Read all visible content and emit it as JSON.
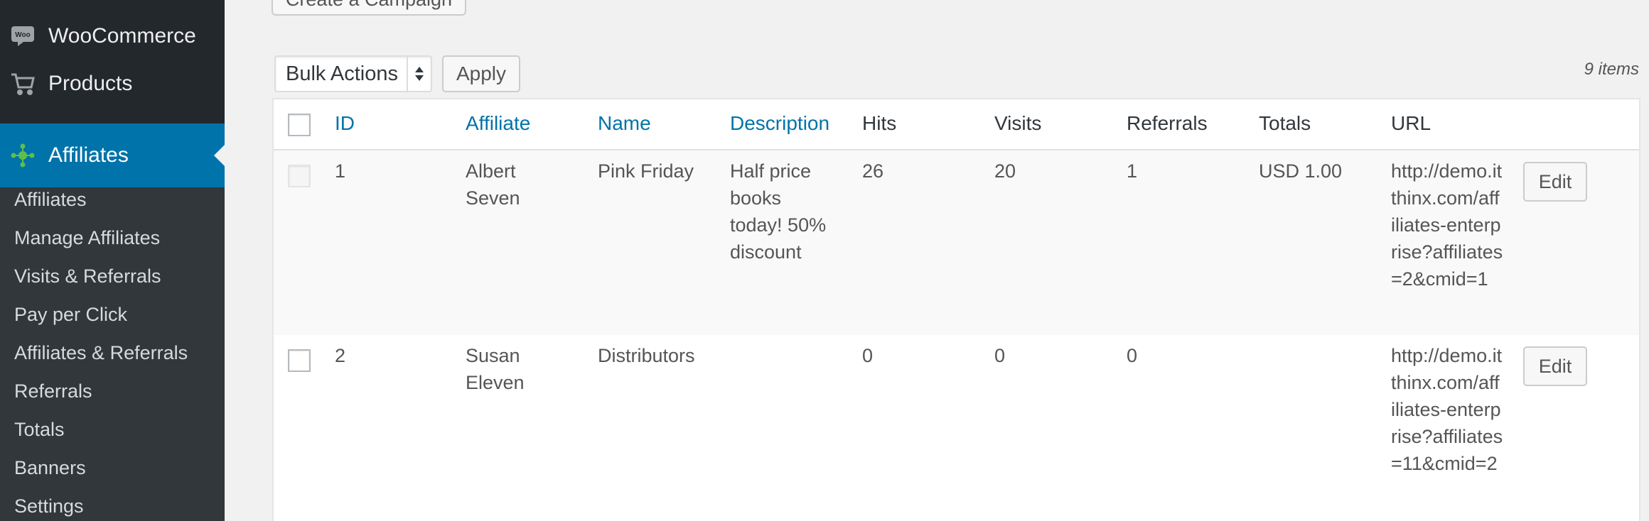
{
  "sidebar": {
    "woocommerce_label": "WooCommerce",
    "woocommerce_icon_text": "Woo",
    "products_label": "Products",
    "affiliates_label": "Affiliates",
    "submenu": [
      "Affiliates",
      "Manage Affiliates",
      "Visits & Referrals",
      "Pay per Click",
      "Affiliates & Referrals",
      "Referrals",
      "Totals",
      "Banners",
      "Settings"
    ]
  },
  "toolbar": {
    "create_campaign_label": "Create a Campaign",
    "bulk_actions_label": "Bulk Actions",
    "apply_label": "Apply",
    "items_count": "9 items"
  },
  "table": {
    "columns": {
      "id": "ID",
      "affiliate": "Affiliate",
      "name": "Name",
      "description": "Description",
      "hits": "Hits",
      "visits": "Visits",
      "referrals": "Referrals",
      "totals": "Totals",
      "url": "URL"
    },
    "edit_label": "Edit",
    "rows": [
      {
        "id": "1",
        "affiliate": "Albert Seven",
        "name": "Pink Friday",
        "description": "Half price books today! 50% discount",
        "hits": "26",
        "visits": "20",
        "referrals": "1",
        "totals": "USD 1.00",
        "url": "http://demo.itthinx.com/affiliates-enterprise?affiliates=2&cmid=1"
      },
      {
        "id": "2",
        "affiliate": "Susan Eleven",
        "name": "Distributors",
        "description": "",
        "hits": "0",
        "visits": "0",
        "referrals": "0",
        "totals": "",
        "url": "http://demo.itthinx.com/affiliates-enterprise?affiliates=11&cmid=2"
      }
    ]
  },
  "colors": {
    "sidebar_bg": "#23282d",
    "submenu_bg": "#32373c",
    "active_menu_bg": "#0073aa",
    "link_color": "#0073aa"
  }
}
